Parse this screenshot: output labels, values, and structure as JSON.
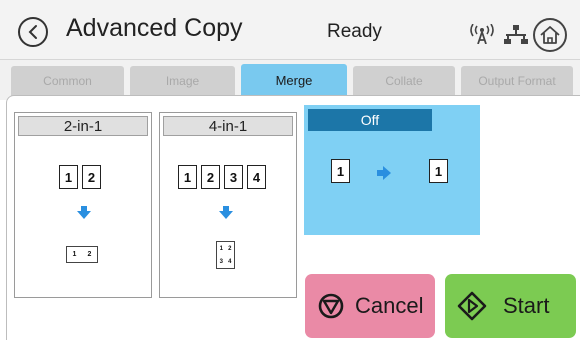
{
  "header": {
    "title": "Advanced Copy",
    "status": "Ready",
    "icons": [
      "back-icon",
      "wireless-icon",
      "network-icon",
      "home-icon"
    ]
  },
  "tabs": [
    {
      "label": "Common",
      "active": false
    },
    {
      "label": "Image",
      "active": false
    },
    {
      "label": "Merge",
      "active": true
    },
    {
      "label": "Collate",
      "active": false
    },
    {
      "label": "Output Format",
      "active": false
    }
  ],
  "options": {
    "two_in_one": {
      "label": "2-in-1",
      "pages": [
        "1",
        "2"
      ],
      "merged": [
        "1",
        "2"
      ]
    },
    "four_in_one": {
      "label": "4-in-1",
      "pages": [
        "1",
        "2",
        "3",
        "4"
      ],
      "merged": [
        "1",
        "2",
        "3",
        "4"
      ]
    },
    "off": {
      "label": "Off",
      "selected": true,
      "source": "1",
      "result": "1"
    }
  },
  "actions": {
    "cancel_label": "Cancel",
    "start_label": "Start"
  },
  "colors": {
    "active_tab": "#79c9ef",
    "selected_option": "#7fd0f4",
    "selected_label": "#1c76a8",
    "arrow": "#2a8fe0",
    "cancel": "#ea8aa6",
    "start": "#7ccb52"
  }
}
